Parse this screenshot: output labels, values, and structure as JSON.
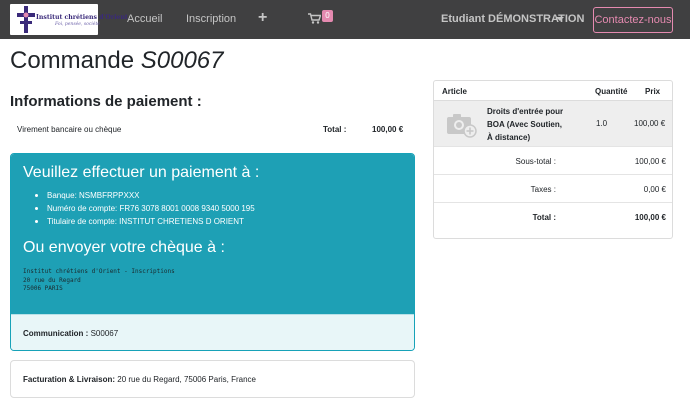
{
  "navbar": {
    "logo_line1": "Institut chrétiens d'Orient",
    "logo_line2": "Foi, pensée, société",
    "links": [
      "Accueil",
      "Inscription"
    ],
    "plus_icon": "plus-icon",
    "cart_icon": "shopping-cart-icon",
    "cart_count": "0",
    "user": "Etudiant DÉMONSTRATION",
    "contact": "Contactez-nous",
    "colors": {
      "bar": "#404041",
      "accent": "#e58ab0"
    }
  },
  "order": {
    "title_prefix": "Commande",
    "reference": "S00067"
  },
  "payment": {
    "section_title": "Informations de paiement :",
    "method": "Virement bancaire ou chèque",
    "total_label": "Total :",
    "total_value": "100,00 €",
    "instructions_title": "Veuillez effectuer un paiement à :",
    "bank_details": [
      "Banque:  NSMBFRPPXXX",
      "Numéro de compte: FR76 3078 8001 0008 9340 5000 195",
      "Titulaire de compte: INSTITUT CHRETIENS D ORIENT"
    ],
    "cheque_title": "Ou envoyer votre chèque à :",
    "cheque_address": "Institut chrétiens d'Orient - Inscriptions\n20 rue du Regard\n75006 PARIS",
    "communication_label": "Communication :",
    "communication_value": "S00067",
    "colors": {
      "card": "#1ea0b5",
      "footer": "#e8f6f8"
    }
  },
  "billing": {
    "label": "Facturation & Livraison:",
    "address": "20 rue du Regard, 75006 Paris, France"
  },
  "summary": {
    "headers": {
      "article": "Article",
      "quantity": "Quantité",
      "price": "Prix"
    },
    "item": {
      "image_icon": "camera-placeholder-icon",
      "name": "Droits d'entrée pour BOA (Avec Soutien, À distance)",
      "quantity": "1.0",
      "price": "100,00 €"
    },
    "subtotal_label": "Sous-total :",
    "subtotal_value": "100,00 €",
    "taxes_label": "Taxes :",
    "taxes_value": "0,00 €",
    "total_label": "Total :",
    "total_value": "100,00 €"
  }
}
